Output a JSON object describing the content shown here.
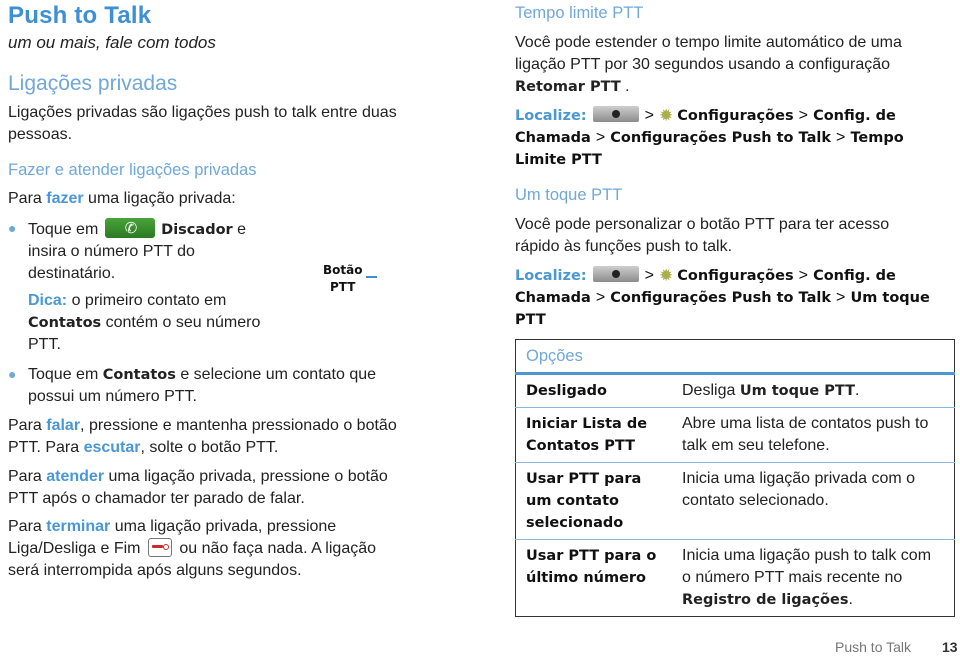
{
  "title": "Push to Talk",
  "subtitle": "um ou mais, fale com todos",
  "left": {
    "section_heading": "Ligações privadas",
    "intro": "Ligações privadas são ligações push to talk entre duas pessoas.",
    "subheading": "Fazer e atender ligações privadas",
    "make_intro": {
      "pre": "Para ",
      "kw": "fazer",
      "post": " uma ligação privada:"
    },
    "bullet1": {
      "pre": "Toque em ",
      "icon": "phone-dialer-icon",
      "label": "Discador",
      "post_line1": " e",
      "line2": "insira o número PTT do",
      "line3": "destinatário."
    },
    "tip": {
      "kw": "Dica:",
      "line1": " o primeiro contato em",
      "bold": "Contatos",
      "line2": " contém o seu número",
      "line3": "PTT."
    },
    "bullet2": {
      "pre": "Toque em ",
      "bold": "Contatos",
      "post": " e selecione um contato que",
      "line2": "possui um número PTT."
    },
    "talk": {
      "pre": "Para ",
      "kw1": "falar",
      "mid": ", pressione e mantenha pressionado o botão",
      "line2pre": "PTT. Para ",
      "kw2": "escutar",
      "line2post": ", solte o botão PTT."
    },
    "answer": {
      "pre": "Para ",
      "kw": "atender",
      "post": " uma ligação privada, pressione o botão",
      "line2": "PTT após o chamador ter parado de falar."
    },
    "end": {
      "pre": "Para ",
      "kw": "terminar",
      "post": " uma ligação privada, pressione",
      "line2pre": "Liga/Desliga e Fim",
      "icon": "end-call-icon",
      "line2post": " ou não faça nada. A ligação",
      "line3": "será interrompida após alguns segundos."
    },
    "ptt_label": {
      "line1": "Botão",
      "line2": "PTT"
    }
  },
  "right": {
    "timeout": {
      "heading": "Tempo limite PTT",
      "line1": "Você pode estender o tempo limite automático de uma",
      "line2": "ligação PTT por 30 segundos usando a configuração",
      "bold": "Retomar PTT",
      "post": " ."
    },
    "locate1": {
      "label": "Localize:",
      "sep": ">",
      "l1_a": "Configurações",
      "l1_b": "Config. de",
      "l2_a": "Chamada",
      "l2_b": "Configurações Push to Talk",
      "l2_c": "Tempo",
      "l3": "Limite PTT"
    },
    "onetouch": {
      "heading": "Um toque PTT",
      "line1": "Você pode personalizar o botão PTT para ter acesso",
      "line2": "rápido às funções push to talk."
    },
    "locate2": {
      "label": "Localize:",
      "sep": ">",
      "l1_a": "Configurações",
      "l1_b": "Config. de",
      "l2_a": "Chamada",
      "l2_b": "Configurações Push to Talk",
      "l2_c": "Um toque",
      "l3": "PTT"
    },
    "options": {
      "header": "Opções",
      "rows": [
        {
          "key": "Desligado",
          "desc_pre": "Desliga ",
          "desc_bold": "Um toque PTT",
          "desc_post": "."
        },
        {
          "key": "Iniciar Lista de Contatos PTT",
          "desc_pre": "Abre uma lista de contatos push to talk em seu telefone.",
          "desc_bold": "",
          "desc_post": ""
        },
        {
          "key": "Usar PTT para um contato selecionado",
          "desc_pre": "Inicia uma ligação privada com o contato selecionado.",
          "desc_bold": "",
          "desc_post": ""
        },
        {
          "key": "Usar PTT para o último número",
          "desc_pre": "Inicia uma ligação push to talk com o número PTT mais recente no ",
          "desc_bold": "Registro de ligações",
          "desc_post": "."
        }
      ]
    }
  },
  "footer": {
    "section": "Push to Talk",
    "page": "13"
  }
}
